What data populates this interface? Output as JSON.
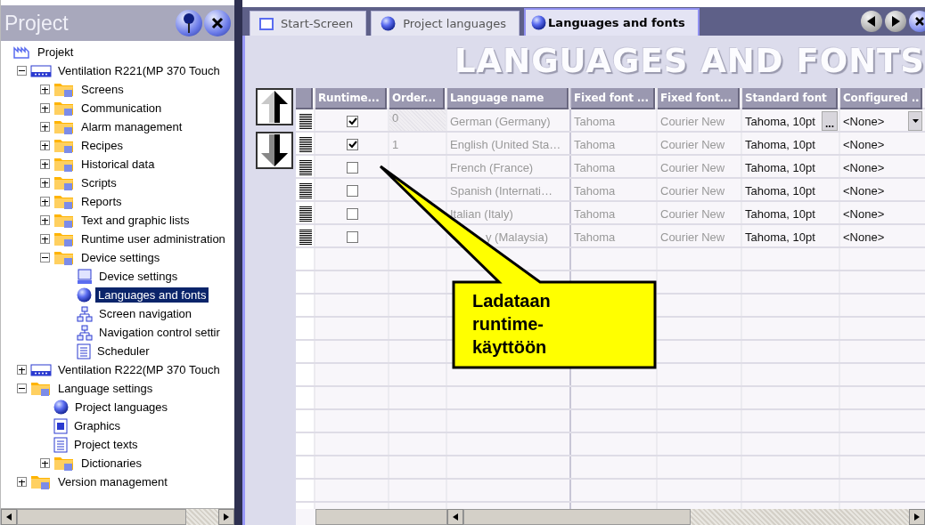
{
  "project_panel": {
    "title": "Project",
    "tree": [
      {
        "label": "Projekt",
        "kind": "factory",
        "selected": false,
        "children": [
          {
            "label": "Ventilation R221(MP 370 Touch",
            "kind": "device",
            "selected": false,
            "expanded": true,
            "children": [
              {
                "label": "Screens",
                "kind": "folder",
                "selected": false,
                "expanded": false
              },
              {
                "label": "Communication",
                "kind": "folder",
                "selected": false,
                "expanded": false
              },
              {
                "label": "Alarm management",
                "kind": "folder",
                "selected": false,
                "expanded": false
              },
              {
                "label": "Recipes",
                "kind": "folder",
                "selected": false,
                "expanded": false
              },
              {
                "label": "Historical data",
                "kind": "folder",
                "selected": false,
                "expanded": false
              },
              {
                "label": "Scripts",
                "kind": "folder",
                "selected": false,
                "expanded": false
              },
              {
                "label": "Reports",
                "kind": "folder",
                "selected": false,
                "expanded": false
              },
              {
                "label": "Text and graphic lists",
                "kind": "folder",
                "selected": false,
                "expanded": false
              },
              {
                "label": "Runtime user administration",
                "kind": "folder",
                "selected": false,
                "expanded": false
              },
              {
                "label": "Device settings",
                "kind": "folder",
                "selected": false,
                "expanded": true,
                "children": [
                  {
                    "label": "Device settings",
                    "kind": "monitor",
                    "selected": false
                  },
                  {
                    "label": "Languages and fonts",
                    "kind": "globe",
                    "selected": true
                  },
                  {
                    "label": "Screen navigation",
                    "kind": "network",
                    "selected": false
                  },
                  {
                    "label": "Navigation control settir",
                    "kind": "network",
                    "selected": false
                  },
                  {
                    "label": "Scheduler",
                    "kind": "list",
                    "selected": false
                  }
                ]
              }
            ]
          },
          {
            "label": "Ventilation R222(MP 370 Touch",
            "kind": "device",
            "selected": false,
            "expanded": false
          },
          {
            "label": "Language settings",
            "kind": "folder",
            "selected": false,
            "expanded": true,
            "children": [
              {
                "label": "Project languages",
                "kind": "globe",
                "selected": false
              },
              {
                "label": "Graphics",
                "kind": "page",
                "selected": false
              },
              {
                "label": "Project texts",
                "kind": "list",
                "selected": false
              },
              {
                "label": "Dictionaries",
                "kind": "folder",
                "selected": false,
                "expanded": false
              }
            ]
          },
          {
            "label": "Version management",
            "kind": "folder",
            "selected": false,
            "expanded": false
          }
        ]
      }
    ]
  },
  "tabs": [
    {
      "label": "Start-Screen",
      "kind": "screen",
      "selected": false
    },
    {
      "label": "Project languages",
      "kind": "globe",
      "selected": false
    },
    {
      "label": "Languages and fonts",
      "kind": "globe",
      "selected": true
    }
  ],
  "editor": {
    "title": "LANGUAGES AND FONTS",
    "table": {
      "columns": [
        "Runtime...",
        "Order...",
        "Language name",
        "Fixed font ...",
        "Fixed font...",
        "Standard font",
        "Configured .."
      ],
      "rows": [
        {
          "checked": true,
          "order": "0",
          "language": "German (Germany)",
          "fixed_font_1": "Tahoma",
          "fixed_font_2": "Courier New",
          "standard_font": "Tahoma, 10pt",
          "edit_button": "...",
          "configured": "<None>",
          "active": true
        },
        {
          "checked": true,
          "order": "1",
          "language": "English (United Sta…",
          "fixed_font_1": "Tahoma",
          "fixed_font_2": "Courier New",
          "standard_font": "Tahoma, 10pt",
          "configured": "<None>",
          "active": false
        },
        {
          "checked": false,
          "language": "French (France)",
          "fixed_font_1": "Tahoma",
          "fixed_font_2": "Courier New",
          "standard_font": "Tahoma, 10pt",
          "configured": "<None>",
          "active": false
        },
        {
          "checked": false,
          "language": "Spanish (Internati…",
          "fixed_font_1": "Tahoma",
          "fixed_font_2": "Courier New",
          "standard_font": "Tahoma, 10pt",
          "configured": "<None>",
          "active": false
        },
        {
          "checked": false,
          "language": "Italian (Italy)",
          "fixed_font_1": "Tahoma",
          "fixed_font_2": "Courier New",
          "standard_font": "Tahoma, 10pt",
          "configured": "<None>",
          "active": false
        },
        {
          "checked": false,
          "language": "y (Malaysia)",
          "covered": true,
          "fixed_font_1": "Tahoma",
          "fixed_font_2": "Courier New",
          "standard_font": "Tahoma, 10pt",
          "configured": "<None>",
          "active": false
        }
      ]
    }
  },
  "callout": {
    "text": "Ladataan runtime-käyttöön"
  }
}
